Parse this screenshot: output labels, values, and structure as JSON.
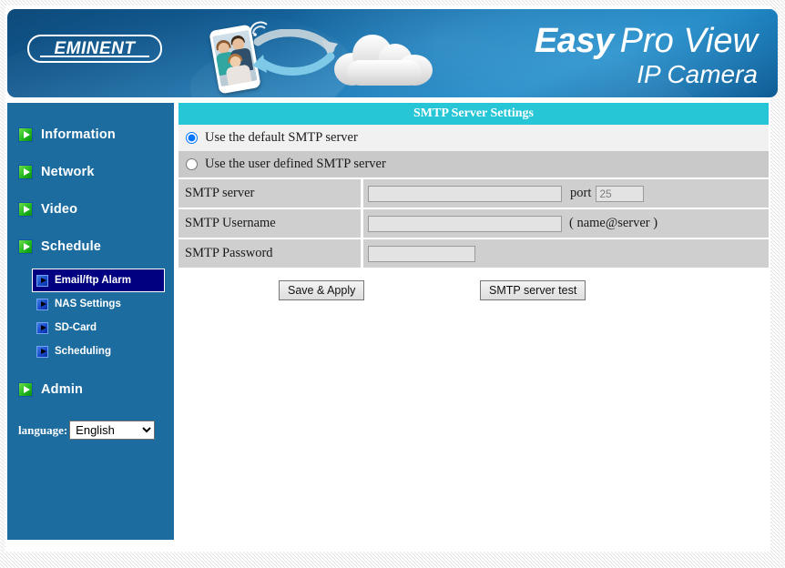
{
  "banner": {
    "logo_text": "EMINENT",
    "brand_easy": "Easy",
    "brand_proview": "Pro View",
    "brand_sub": "IP Camera",
    "graphic_icons": [
      "smartphone-icon",
      "wifi-icon",
      "arrow-icon",
      "cloud-icon"
    ]
  },
  "sidebar": {
    "main_items": [
      {
        "label": "Information",
        "icon": "green-play-icon"
      },
      {
        "label": "Network",
        "icon": "green-play-icon"
      },
      {
        "label": "Video",
        "icon": "green-play-icon"
      },
      {
        "label": "Schedule",
        "icon": "green-play-icon"
      }
    ],
    "sub_items": [
      {
        "label": "Email/ftp Alarm",
        "icon": "blue-play-icon",
        "selected": true
      },
      {
        "label": "NAS Settings",
        "icon": "blue-play-icon",
        "selected": false
      },
      {
        "label": "SD-Card",
        "icon": "blue-play-icon",
        "selected": false
      },
      {
        "label": "Scheduling",
        "icon": "blue-play-icon",
        "selected": false
      }
    ],
    "admin_item": {
      "label": "Admin",
      "icon": "green-play-icon"
    },
    "language": {
      "label": "language:",
      "selected": "English",
      "options": [
        "English"
      ]
    }
  },
  "content": {
    "section_title": "SMTP Server Settings",
    "radio_options": [
      {
        "label": "Use the default SMTP server",
        "checked": true
      },
      {
        "label": "Use the user defined SMTP server",
        "checked": false
      }
    ],
    "fields": [
      {
        "label": "SMTP server",
        "value": "",
        "placeholder": "",
        "port_label": "port",
        "port_value": "25"
      },
      {
        "label": "SMTP Username",
        "value": "",
        "placeholder": "",
        "hint": "( name@server )"
      },
      {
        "label": "SMTP Password",
        "value": "",
        "placeholder": ""
      }
    ],
    "buttons": {
      "save": "Save & Apply",
      "test": "SMTP server test"
    }
  },
  "colors": {
    "banner_blue": "#1a79b6",
    "sidebar_blue": "#1c6ca0",
    "header_cyan": "#27c6d6",
    "selected_navy": "#000080",
    "row_light": "#f1f1f1",
    "row_dark": "#c9c9c9",
    "field_gray": "#cfcfcf"
  }
}
